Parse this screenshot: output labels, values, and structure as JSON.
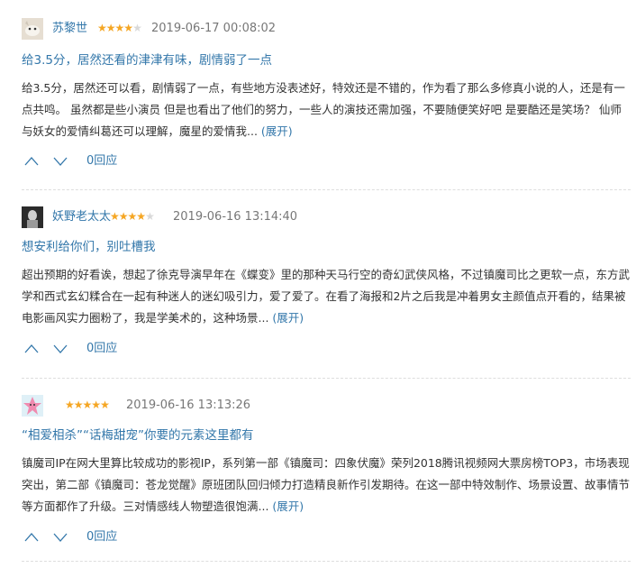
{
  "reviews": [
    {
      "author": "苏黎世",
      "rating": 4.5,
      "stars": [
        "★",
        "★",
        "★",
        "★",
        "★"
      ],
      "date": "2019-06-17 00:08:02",
      "title": "给3.5分，居然还看的津津有味，剧情弱了一点",
      "body": "给3.5分，居然还可以看，剧情弱了一点，有些地方没表述好，特效还是不错的，作为看了那么多修真小说的人，还是有一点共鸣。 虽然都是些小演员 但是也看出了他们的努力，一些人的演技还需加强，不要随便笑好吧 是要酷还是笑场？ 仙师与妖女的爱情纠葛还可以理解，魔星的爱情我... ",
      "expand": "(展开)",
      "up_icon": "thumb-up-icon",
      "down_icon": "thumb-down-icon",
      "replies": "0回应"
    },
    {
      "author": "妖野老太太",
      "rating": 4,
      "stars": [
        "★",
        "★",
        "★",
        "★",
        "★"
      ],
      "date": "2019-06-16 13:14:40",
      "title": "想安利给你们，别吐槽我",
      "body": "超出预期的好看诶，想起了徐克导演早年在《蝶变》里的那种天马行空的奇幻武侠风格，不过镇魔司比之更软一点，东方武学和西式玄幻糅合在一起有种迷人的迷幻吸引力，爱了爱了。在看了海报和2片之后我是冲着男女主颜值点开看的，结果被电影画风实力圈粉了，我是学美术的，这种场景... ",
      "expand": "(展开)",
      "up_icon": "thumb-up-icon",
      "down_icon": "thumb-down-icon",
      "replies": "0回应"
    },
    {
      "author": "",
      "rating": 5,
      "stars": [
        "★",
        "★",
        "★",
        "★",
        "★"
      ],
      "date": "2019-06-16 13:13:26",
      "title": "“相爱相杀”“话梅甜宠”你要的元素这里都有",
      "body": "镇魔司IP在网大里算比较成功的影视IP，系列第一部《镇魔司：四象伏魔》荣列2018腾讯视频网大票房榜TOP3，市场表现突出，第二部《镇魔司：苍龙觉醒》原班团队回归倾力打造精良新作引发期待。在这一部中特效制作、场景设置、故事情节等方面都作了升级。三对情感线人物塑造很饱满... ",
      "expand": "(展开)",
      "up_icon": "thumb-up-icon",
      "down_icon": "thumb-down-icon",
      "replies": "0回应"
    }
  ],
  "colors": {
    "link": "#3377aa",
    "text": "#333333",
    "date": "#777777",
    "star_on": "#f5a623",
    "star_off": "#d9d9d9",
    "divider": "#dddddd"
  }
}
